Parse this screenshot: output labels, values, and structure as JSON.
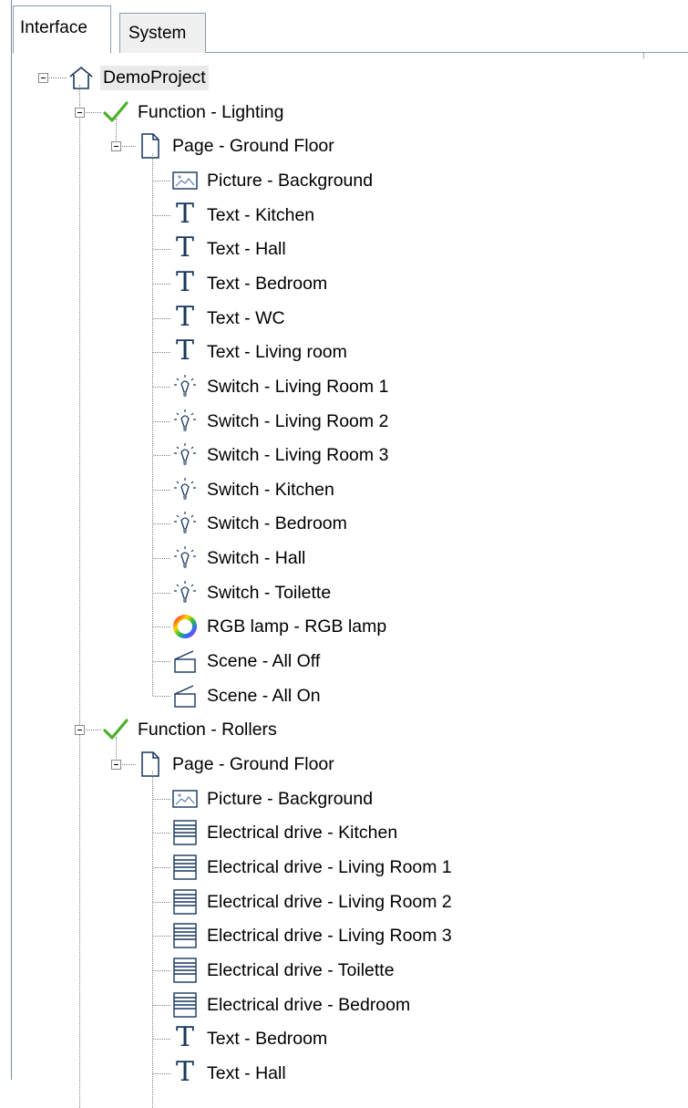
{
  "tabs": [
    {
      "label": "Interface",
      "active": true
    },
    {
      "label": "System",
      "active": false
    }
  ],
  "tree": {
    "root": {
      "label": "DemoProject",
      "icon": "home-icon"
    },
    "functions": [
      {
        "label": "Function - Lighting",
        "icon": "checkmark-icon",
        "page": {
          "label": "Page - Ground Floor",
          "icon": "page-icon",
          "items": [
            {
              "label": "Picture - Background",
              "icon": "picture-icon"
            },
            {
              "label": "Text - Kitchen",
              "icon": "text-icon"
            },
            {
              "label": "Text - Hall",
              "icon": "text-icon"
            },
            {
              "label": "Text - Bedroom",
              "icon": "text-icon"
            },
            {
              "label": "Text - WC",
              "icon": "text-icon"
            },
            {
              "label": "Text - Living room",
              "icon": "text-icon"
            },
            {
              "label": "Switch - Living Room 1",
              "icon": "light-bulb-icon"
            },
            {
              "label": "Switch - Living Room 2",
              "icon": "light-bulb-icon"
            },
            {
              "label": "Switch - Living Room 3",
              "icon": "light-bulb-icon"
            },
            {
              "label": "Switch - Kitchen",
              "icon": "light-bulb-icon"
            },
            {
              "label": "Switch - Bedroom",
              "icon": "light-bulb-icon"
            },
            {
              "label": "Switch - Hall",
              "icon": "light-bulb-icon"
            },
            {
              "label": "Switch - Toilette",
              "icon": "light-bulb-icon"
            },
            {
              "label": "RGB lamp - RGB lamp",
              "icon": "color-wheel-icon"
            },
            {
              "label": "Scene - All Off",
              "icon": "scene-icon"
            },
            {
              "label": "Scene - All On",
              "icon": "scene-icon"
            }
          ]
        }
      },
      {
        "label": "Function - Rollers",
        "icon": "checkmark-icon",
        "page": {
          "label": "Page - Ground Floor",
          "icon": "page-icon",
          "items": [
            {
              "label": "Picture - Background",
              "icon": "picture-icon"
            },
            {
              "label": "Electrical drive - Kitchen",
              "icon": "roller-blind-icon"
            },
            {
              "label": "Electrical drive - Living Room 1",
              "icon": "roller-blind-icon"
            },
            {
              "label": "Electrical drive - Living Room 2",
              "icon": "roller-blind-icon"
            },
            {
              "label": "Electrical drive - Living Room 3",
              "icon": "roller-blind-icon"
            },
            {
              "label": "Electrical drive - Toilette",
              "icon": "roller-blind-icon"
            },
            {
              "label": "Electrical drive - Bedroom",
              "icon": "roller-blind-icon"
            },
            {
              "label": "Text - Bedroom",
              "icon": "text-icon"
            },
            {
              "label": "Text - Hall",
              "icon": "text-icon"
            }
          ]
        }
      }
    ]
  },
  "colors": {
    "check": "#4caf2a",
    "icon_blue": "#17365d",
    "selected_bg": "#eaeaea"
  }
}
